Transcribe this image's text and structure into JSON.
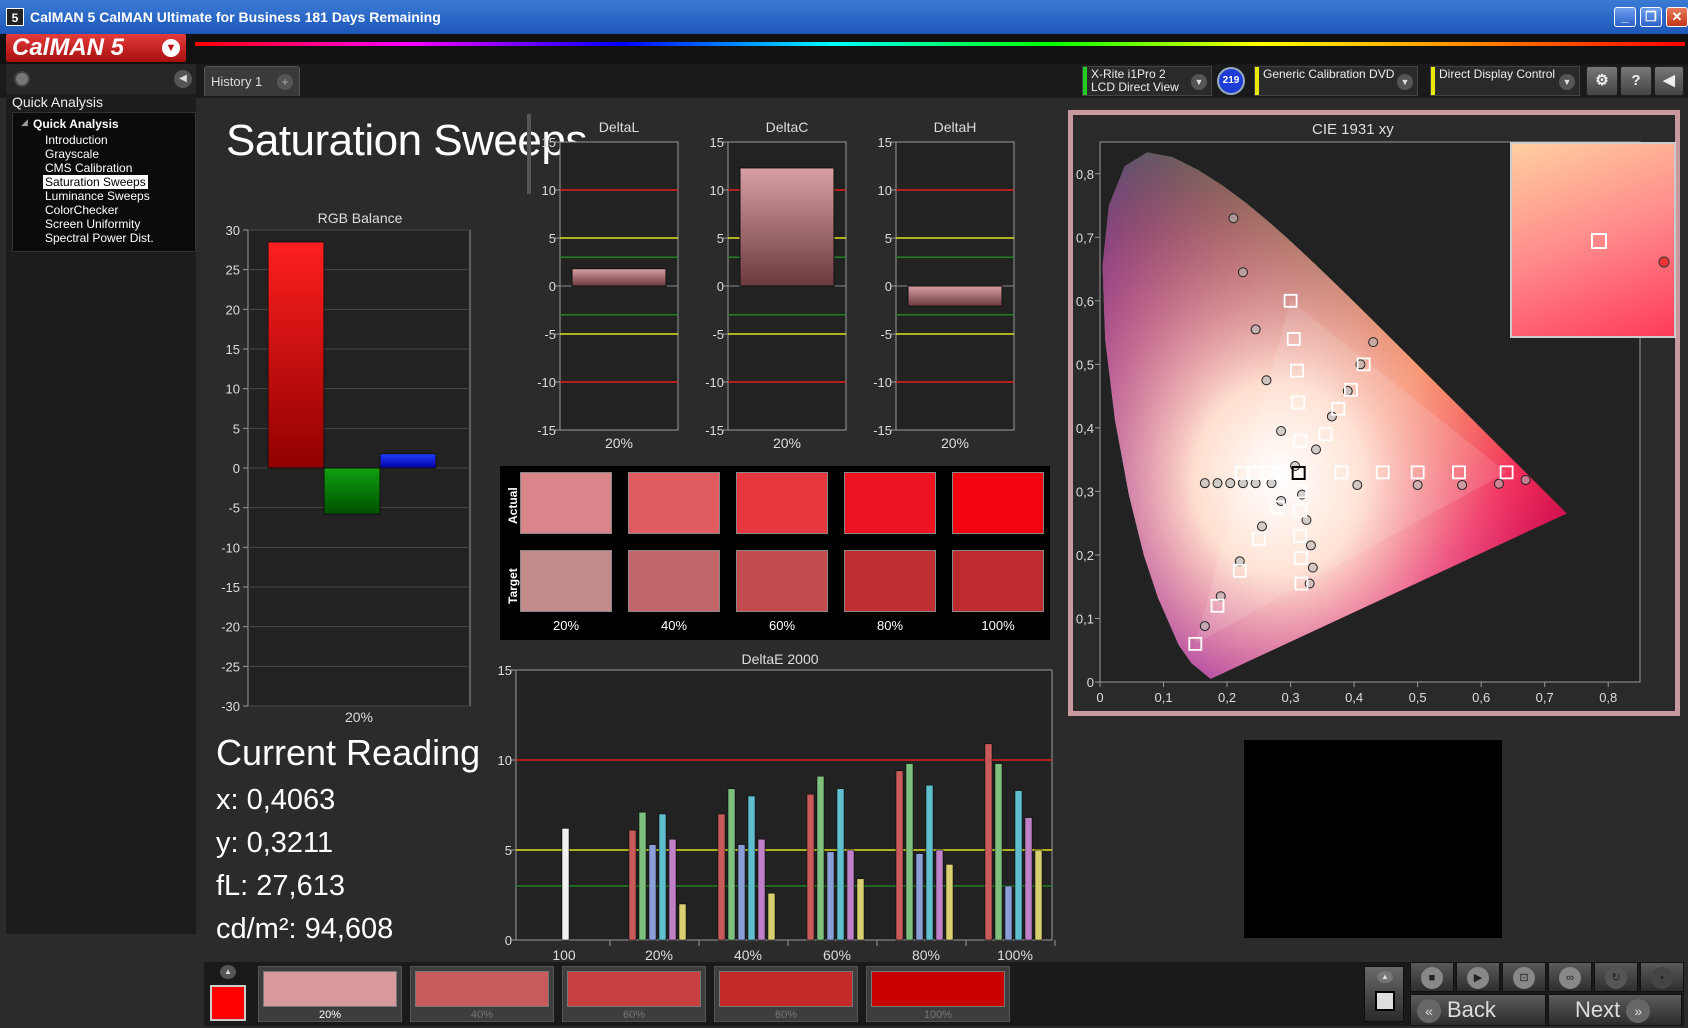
{
  "window": {
    "title": "CalMAN 5 CalMAN Ultimate for Business 181 Days Remaining",
    "icon_text": "5"
  },
  "header": {
    "logo_text": "CalMAN 5"
  },
  "tabs": {
    "history_label": "History 1",
    "add_label": "+"
  },
  "devices": {
    "meter_line1": "X-Rite i1Pro 2",
    "meter_line2": "LCD Direct View",
    "meter_badge": "219",
    "source": "Generic Calibration DVD",
    "display": "Direct Display Control",
    "meter_color": "#22cc22",
    "source_color": "#e8e800",
    "display_color": "#e8e800"
  },
  "sidebar": {
    "title": "Quick Analysis",
    "root": "Quick Analysis",
    "items": [
      "Introduction",
      "Grayscale",
      "CMS Calibration",
      "Saturation Sweeps",
      "Luminance Sweeps",
      "ColorChecker",
      "Screen Uniformity",
      "Spectral Power Dist."
    ],
    "selected_index": 3
  },
  "page": {
    "title": "Saturation Sweeps"
  },
  "rgb_balance": {
    "title": "RGB Balance",
    "yticks": [
      "30",
      "25",
      "20",
      "15",
      "10",
      "5",
      "0",
      "-5",
      "-10",
      "-15",
      "-20",
      "-25",
      "-30"
    ],
    "category": "20%"
  },
  "delta_charts": [
    {
      "title": "DeltaL",
      "category": "20%"
    },
    {
      "title": "DeltaC",
      "category": "20%"
    },
    {
      "title": "DeltaH",
      "category": "20%"
    }
  ],
  "delta_yticks": [
    "15",
    "10",
    "5",
    "0",
    "-5",
    "-10",
    "-15"
  ],
  "swatches": {
    "row_actual": "Actual",
    "row_target": "Target",
    "labels": [
      "20%",
      "40%",
      "60%",
      "80%",
      "100%"
    ],
    "actual_colors": [
      "#d9858a",
      "#e05c61",
      "#e6373f",
      "#ee1320",
      "#f50211"
    ],
    "target_colors": [
      "#c38b8b",
      "#c36669",
      "#c24b4d",
      "#bf2e33",
      "#bd2a30"
    ]
  },
  "deltae_chart": {
    "title": "DeltaE 2000",
    "yticks": [
      "15",
      "10",
      "5",
      "0"
    ],
    "categories": [
      "100",
      "20%",
      "40%",
      "60%",
      "80%",
      "100%"
    ]
  },
  "cie": {
    "title": "CIE 1931 xy",
    "xticks": [
      "0",
      "0,1",
      "0,2",
      "0,3",
      "0,4",
      "0,5",
      "0,6",
      "0,7",
      "0,8"
    ],
    "yticks": [
      "0,8",
      "0,7",
      "0,6",
      "0,5",
      "0,4",
      "0,3",
      "0,2",
      "0,1",
      "0"
    ]
  },
  "current_reading": {
    "title": "Current Reading",
    "x": "x: 0,4063",
    "y": "y: 0,3211",
    "fl": "fL: 27,613",
    "cdm2": "cd/m²: 94,608"
  },
  "bottom_swatches": {
    "labels": [
      "20%",
      "40%",
      "60%",
      "80%",
      "100%"
    ],
    "colors": [
      "#d99a9e",
      "#c85a5c",
      "#c94040",
      "#c42a2a",
      "#c80000"
    ],
    "active_index": 0
  },
  "nav": {
    "back": "Back",
    "next": "Next"
  },
  "chart_data": [
    {
      "type": "bar",
      "title": "RGB Balance",
      "categories": [
        "20%"
      ],
      "series": [
        {
          "name": "Red",
          "values": [
            28.5
          ],
          "color": "#e00000"
        },
        {
          "name": "Green",
          "values": [
            -5.8
          ],
          "color": "#008000"
        },
        {
          "name": "Blue",
          "values": [
            1.8
          ],
          "color": "#0000e0"
        }
      ],
      "ylim": [
        -30,
        30
      ]
    },
    {
      "type": "bar",
      "title": "DeltaL",
      "categories": [
        "20%"
      ],
      "values": [
        1.8
      ],
      "ylim": [
        -15,
        15
      ]
    },
    {
      "type": "bar",
      "title": "DeltaC",
      "categories": [
        "20%"
      ],
      "values": [
        12.3
      ],
      "ylim": [
        -15,
        15
      ]
    },
    {
      "type": "bar",
      "title": "DeltaH",
      "categories": [
        "20%"
      ],
      "values": [
        -2.1
      ],
      "ylim": [
        -15,
        15
      ]
    },
    {
      "type": "bar",
      "title": "DeltaE 2000",
      "categories": [
        "100",
        "20%",
        "40%",
        "60%",
        "80%",
        "100%"
      ],
      "series": [
        {
          "name": "White",
          "values": [
            6.2,
            null,
            null,
            null,
            null,
            null
          ],
          "color": "#f0f0f0"
        },
        {
          "name": "Red",
          "values": [
            null,
            6.1,
            7.0,
            8.1,
            9.4,
            10.9
          ],
          "color": "#c85a5a"
        },
        {
          "name": "Green",
          "values": [
            null,
            7.1,
            8.4,
            9.1,
            9.8,
            9.8
          ],
          "color": "#7fc07f"
        },
        {
          "name": "Blue",
          "values": [
            null,
            5.3,
            5.3,
            4.9,
            4.8,
            3.0
          ],
          "color": "#8a9fd8"
        },
        {
          "name": "Cyan",
          "values": [
            null,
            7.0,
            8.0,
            8.4,
            8.6,
            8.3
          ],
          "color": "#5fbfcf"
        },
        {
          "name": "Magenta",
          "values": [
            null,
            5.6,
            5.6,
            5.0,
            5.0,
            6.8
          ],
          "color": "#c080c8"
        },
        {
          "name": "Yellow",
          "values": [
            null,
            2.0,
            2.6,
            3.4,
            4.2,
            5.0
          ],
          "color": "#d8d070"
        }
      ],
      "ylim": [
        0,
        15
      ],
      "thresholds": [
        10,
        5,
        3
      ]
    },
    {
      "type": "scatter",
      "title": "CIE 1931 xy",
      "xlim": [
        0,
        0.85
      ],
      "ylim": [
        0,
        0.85
      ],
      "target_gamut": [
        [
          0.64,
          0.33
        ],
        [
          0.3,
          0.6
        ],
        [
          0.15,
          0.06
        ]
      ],
      "measured_points": [
        [
          0.21,
          0.73
        ],
        [
          0.225,
          0.645
        ],
        [
          0.245,
          0.555
        ],
        [
          0.262,
          0.475
        ],
        [
          0.285,
          0.395
        ],
        [
          0.307,
          0.34
        ],
        [
          0.165,
          0.313
        ],
        [
          0.185,
          0.313
        ],
        [
          0.205,
          0.313
        ],
        [
          0.225,
          0.313
        ],
        [
          0.245,
          0.313
        ],
        [
          0.27,
          0.313
        ],
        [
          0.43,
          0.535
        ],
        [
          0.41,
          0.5
        ],
        [
          0.39,
          0.458
        ],
        [
          0.365,
          0.418
        ],
        [
          0.34,
          0.366
        ],
        [
          0.405,
          0.31
        ],
        [
          0.5,
          0.31
        ],
        [
          0.57,
          0.31
        ],
        [
          0.628,
          0.312
        ],
        [
          0.67,
          0.318
        ],
        [
          0.165,
          0.088
        ],
        [
          0.19,
          0.135
        ],
        [
          0.22,
          0.19
        ],
        [
          0.255,
          0.245
        ],
        [
          0.285,
          0.285
        ],
        [
          0.33,
          0.155
        ],
        [
          0.335,
          0.18
        ],
        [
          0.332,
          0.215
        ],
        [
          0.325,
          0.255
        ],
        [
          0.318,
          0.295
        ]
      ],
      "target_points": [
        [
          0.3,
          0.6
        ],
        [
          0.305,
          0.54
        ],
        [
          0.31,
          0.49
        ],
        [
          0.312,
          0.44
        ],
        [
          0.315,
          0.38
        ],
        [
          0.3127,
          0.329
        ],
        [
          0.415,
          0.5
        ],
        [
          0.395,
          0.46
        ],
        [
          0.375,
          0.43
        ],
        [
          0.355,
          0.39
        ],
        [
          0.38,
          0.33
        ],
        [
          0.445,
          0.33
        ],
        [
          0.5,
          0.33
        ],
        [
          0.565,
          0.33
        ],
        [
          0.64,
          0.33
        ],
        [
          0.15,
          0.06
        ],
        [
          0.185,
          0.12
        ],
        [
          0.22,
          0.175
        ],
        [
          0.25,
          0.225
        ],
        [
          0.28,
          0.275
        ],
        [
          0.317,
          0.155
        ],
        [
          0.316,
          0.195
        ],
        [
          0.315,
          0.23
        ],
        [
          0.315,
          0.27
        ],
        [
          0.315,
          0.3
        ],
        [
          0.223,
          0.329
        ],
        [
          0.245,
          0.329
        ],
        [
          0.265,
          0.329
        ],
        [
          0.285,
          0.329
        ]
      ]
    }
  ]
}
